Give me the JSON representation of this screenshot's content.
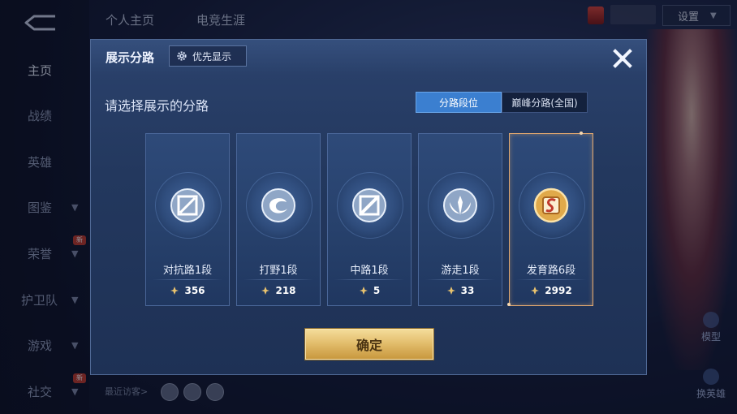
{
  "top_tabs": [
    "个人主页",
    "电竞生涯"
  ],
  "settings_label": "设置",
  "sidebar": {
    "items": [
      {
        "label": "主页",
        "active": true,
        "chevron": false,
        "new": false
      },
      {
        "label": "战绩",
        "active": false,
        "chevron": false,
        "new": false
      },
      {
        "label": "英雄",
        "active": false,
        "chevron": false,
        "new": false
      },
      {
        "label": "图鉴",
        "active": false,
        "chevron": true,
        "new": false
      },
      {
        "label": "荣誉",
        "active": false,
        "chevron": true,
        "new": true
      },
      {
        "label": "护卫队",
        "active": false,
        "chevron": true,
        "new": false
      },
      {
        "label": "游戏",
        "active": false,
        "chevron": true,
        "new": false
      },
      {
        "label": "社交",
        "active": false,
        "chevron": true,
        "new": true
      }
    ],
    "new_badge": "新"
  },
  "right_controls": {
    "model": "模型",
    "switch_hero": "换英雄"
  },
  "recent_visitors_label": "最近访客>",
  "modal": {
    "title": "展示分路",
    "priority_button": "优先显示",
    "subtitle": "请选择展示的分路",
    "segments": {
      "active": "分路段位",
      "inactive": "巅峰分路(全国)"
    },
    "cards": [
      {
        "name": "对抗路1段",
        "score": "356",
        "icon": "clash-lane-icon",
        "selected": false
      },
      {
        "name": "打野1段",
        "score": "218",
        "icon": "jungle-icon",
        "selected": false
      },
      {
        "name": "中路1段",
        "score": "5",
        "icon": "mid-lane-icon",
        "selected": false
      },
      {
        "name": "游走1段",
        "score": "33",
        "icon": "roam-icon",
        "selected": false
      },
      {
        "name": "发育路6段",
        "score": "2992",
        "icon": "farm-lane-icon",
        "selected": true
      }
    ],
    "confirm_label": "确定"
  },
  "colors": {
    "accent_blue": "#3b7fd0",
    "gold": "#e1bb69",
    "selected_border": "#e0a770",
    "modal_bg": "#23385e"
  }
}
